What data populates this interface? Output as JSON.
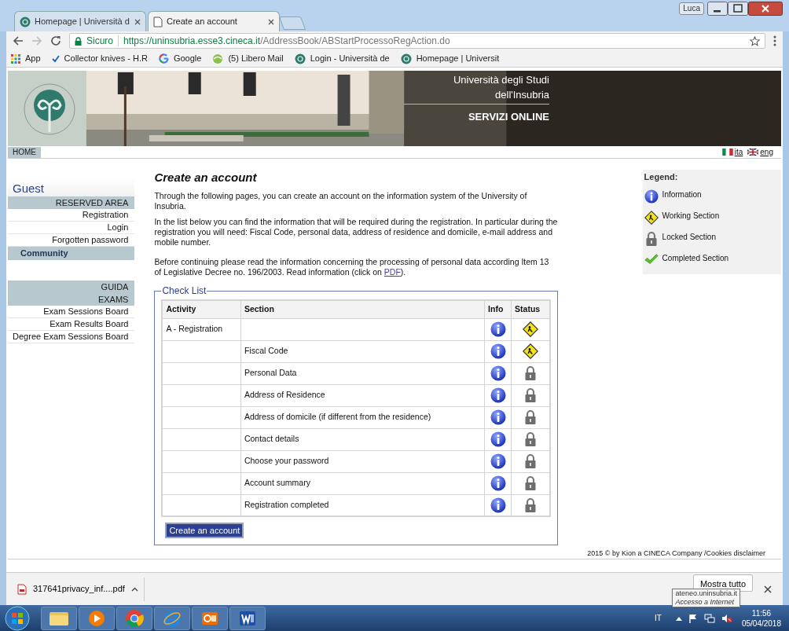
{
  "browser": {
    "tabs": [
      {
        "title": "Homepage | Università d",
        "kind": "uni",
        "selected": false
      },
      {
        "title": "Create an account",
        "kind": "page",
        "selected": true
      }
    ],
    "user": "Luca",
    "address": {
      "security": "Sicuro",
      "host": "https://uninsubria.esse3.cineca.it",
      "path": "/AddressBook/ABStartProcessoRegAction.do"
    },
    "bookmarks": [
      {
        "label": "App",
        "kind": "apps"
      },
      {
        "label": "Collector knives - H.R",
        "kind": "check"
      },
      {
        "label": "Google",
        "kind": "google"
      },
      {
        "label": "(5) Libero Mail",
        "kind": "libero"
      },
      {
        "label": "Login - Università de",
        "kind": "uni"
      },
      {
        "label": "Homepage | Universit",
        "kind": "uni"
      }
    ]
  },
  "header": {
    "title_line1": "Università degli Studi",
    "title_line2": "dell'Insubria",
    "subtitle": "SERVIZI ONLINE"
  },
  "nav": {
    "home": "HOME",
    "languages": [
      {
        "label": "ita",
        "kind": "it"
      },
      {
        "label": "eng",
        "kind": "uk"
      }
    ]
  },
  "sidebar": {
    "user": "Guest",
    "sections": [
      [
        {
          "label": "RESERVED AREA",
          "kind": "header"
        },
        {
          "label": "Registration",
          "kind": "link"
        },
        {
          "label": "Login",
          "kind": "link"
        },
        {
          "label": "Forgotten password",
          "kind": "link"
        },
        {
          "label": "Community",
          "kind": "group"
        }
      ],
      [
        {
          "label": "GUIDA",
          "kind": "header"
        },
        {
          "label": "EXAMS",
          "kind": "header"
        },
        {
          "label": "Exam Sessions Board",
          "kind": "link"
        },
        {
          "label": "Exam Results Board",
          "kind": "link"
        },
        {
          "label": "Degree Exam Sessions Board",
          "kind": "link"
        }
      ]
    ]
  },
  "main": {
    "title": "Create an account",
    "paragraphs": [
      "Through the following pages, you can create an account on the information system of the University of Insubria.",
      "In the list below you can find the information that will be required during the registration. In particular during the registration you will need: Fiscal Code, personal data, address of residence and domicile, e-mail address and mobile number."
    ],
    "notice": {
      "before": "Before continuing please read the information concerning the processing of personal data according Item 13 of Legislative Decree no. 196/2003. Read information (click on ",
      "link": "PDF",
      "after": ")."
    },
    "checklist": {
      "legend": "Check List",
      "columns": [
        "Activity",
        "Section",
        "Info",
        "Status"
      ],
      "rows": [
        {
          "activity": "A - Registration",
          "kind": "working"
        },
        {
          "section": "Fiscal Code",
          "kind": "working"
        },
        {
          "section": "Personal Data",
          "kind": "locked"
        },
        {
          "section": "Address of Residence",
          "kind": "locked"
        },
        {
          "section": "Address of domicile (if different from the residence)",
          "kind": "locked"
        },
        {
          "section": "Contact details",
          "kind": "locked"
        },
        {
          "section": "Choose your password",
          "kind": "locked"
        },
        {
          "section": "Account summary",
          "kind": "locked"
        },
        {
          "section": "Registration completed",
          "kind": "locked"
        }
      ],
      "button": "Create an account"
    }
  },
  "legend": {
    "title": "Legend:",
    "items": [
      {
        "label": "Information",
        "kind": "info"
      },
      {
        "label": "Working Section",
        "kind": "working"
      },
      {
        "label": "Locked Section",
        "kind": "locked"
      },
      {
        "label": "Completed Section",
        "kind": "completed"
      }
    ]
  },
  "footer": "2015 © by Kion a CINECA Company /Cookies disclaimer",
  "downloads": {
    "file": "317641privacy_inf....pdf",
    "show_all": "Mostra tutto"
  },
  "tooltip": {
    "host": "ateneo.uninsubria.it",
    "zone": "Accesso a Internet"
  },
  "taskbar": {
    "apps": [
      {
        "kind": "folder"
      },
      {
        "kind": "media"
      },
      {
        "kind": "chrome"
      },
      {
        "kind": "ie"
      },
      {
        "kind": "outlook"
      },
      {
        "kind": "word"
      }
    ],
    "language": "IT",
    "time": "11:56",
    "date": "05/04/2018"
  }
}
